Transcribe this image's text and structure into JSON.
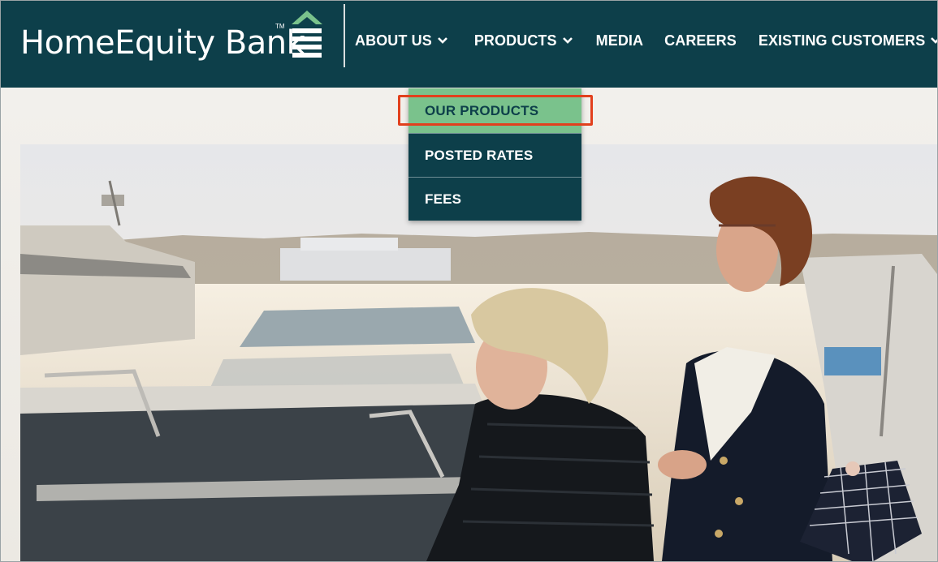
{
  "brand": {
    "name": "HomeEquity Bank",
    "trademark": "TM",
    "colors": {
      "header": "#0d3f4a",
      "accent_green": "#7ac28c",
      "highlight": "#e2401d"
    }
  },
  "nav": {
    "items": [
      {
        "label": "ABOUT US",
        "has_dropdown": true
      },
      {
        "label": "PRODUCTS",
        "has_dropdown": true
      },
      {
        "label": "MEDIA",
        "has_dropdown": false
      },
      {
        "label": "CAREERS",
        "has_dropdown": false
      },
      {
        "label": "EXISTING CUSTOMERS",
        "has_dropdown": true
      }
    ]
  },
  "products_menu": {
    "items": [
      {
        "label": "OUR PRODUCTS",
        "highlighted": true
      },
      {
        "label": "POSTED RATES",
        "highlighted": false
      },
      {
        "label": "FEES",
        "highlighted": false
      }
    ]
  },
  "icons": [
    "logo-stacked-chevron-icon",
    "chevron-down-icon"
  ]
}
